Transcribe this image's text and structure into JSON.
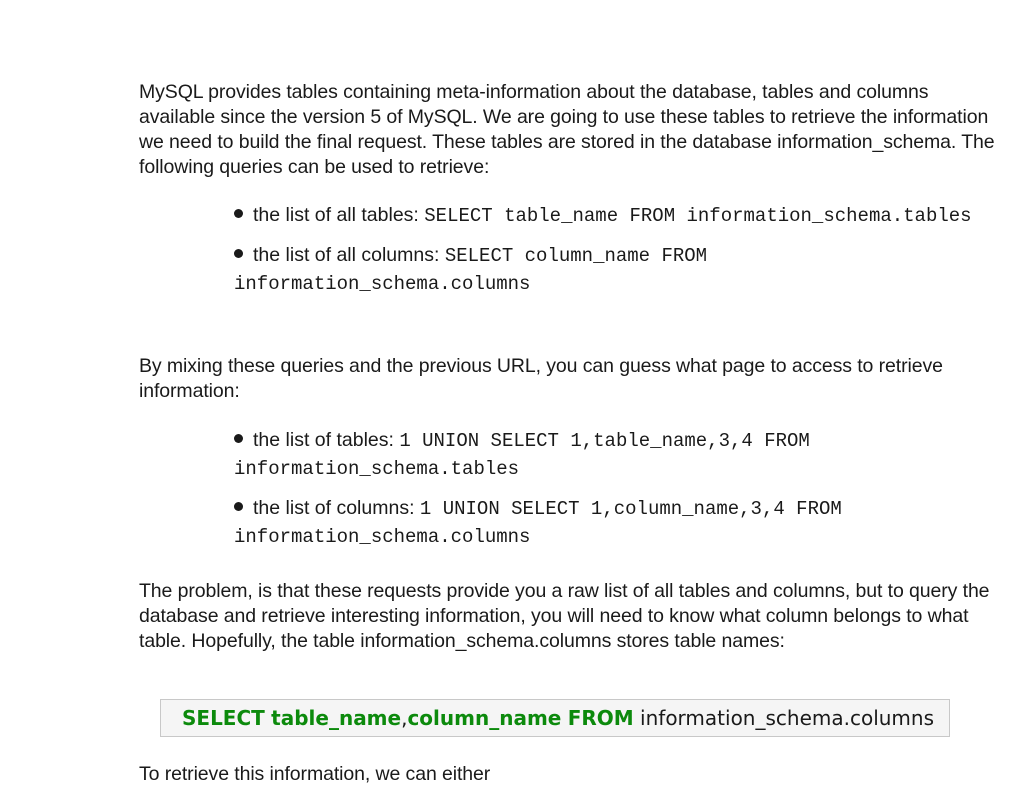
{
  "intro": "MySQL provides tables containing meta-information about the database, tables and columns available since the version 5 of MySQL. We are going to use these tables to retrieve the information we need to build the final request. These tables are stored in the database information_schema. The following queries can be used to retrieve:",
  "list1": [
    {
      "text": "the list of all tables: ",
      "code": "SELECT table_name FROM information_schema.tables"
    },
    {
      "text": "the list of all columns: ",
      "code": "SELECT column_name FROM information_schema.columns"
    }
  ],
  "mixing": "By mixing these queries and the previous URL, you can guess what page to access to retrieve information:",
  "list2": [
    {
      "text": "the list of tables: ",
      "code": "1 UNION SELECT 1,table_name,3,4 FROM information_schema.tables"
    },
    {
      "text": "the list of columns: ",
      "code": "1 UNION SELECT 1,column_name,3,4 FROM information_schema.columns"
    }
  ],
  "problem": "The problem, is that these requests provide you a raw list of all tables and columns, but to query the database and retrieve interesting information, you will need to know what column belongs to what table. Hopefully, the table information_schema.columns stores table names:",
  "query": {
    "kw1": "SELECT",
    "cols": "table_name",
    "comma": ",",
    "cols2": "column_name",
    "kw2": "FROM",
    "table": "information_schema.columns"
  },
  "closing": "To retrieve this information, we can either",
  "colors": {
    "keyword": "#0c8a0c",
    "text": "#1a1a1a",
    "code_box_bg": "#f5f5f5",
    "code_box_border": "#c8c8c8"
  }
}
